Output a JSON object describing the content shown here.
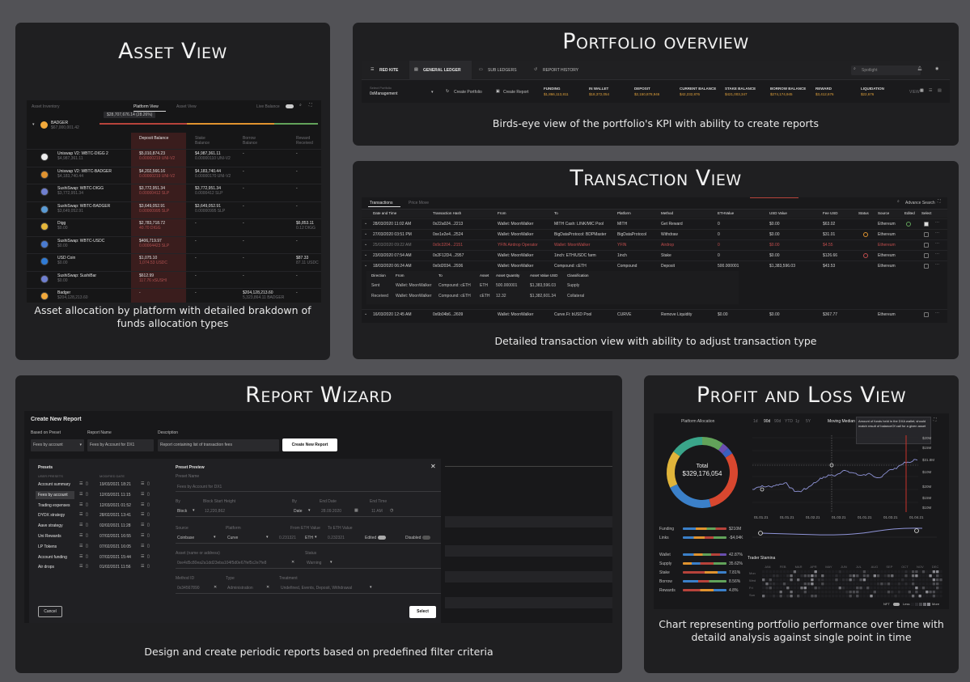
{
  "cards": {
    "asset": {
      "title": "Asset View",
      "caption": "Asset allocation by platform with detailed brakdown of funds allocation types"
    },
    "portfolio": {
      "title": "Portfolio overview",
      "caption": "Birds-eye view of the portfolio's KPI with ability to create reports"
    },
    "transaction": {
      "title": "Transaction View",
      "caption": "Detailed transaction view with ability to adjust transaction type"
    },
    "report": {
      "title": "Report Wizard",
      "caption": "Design and create periodic reports based on predefined filter criteria"
    },
    "pnl": {
      "title": "Profit and Loss View",
      "caption": "Chart representing portfolio performance over time with detaild analysis against single point in time"
    }
  },
  "asset_view": {
    "heading": "Asset Inventory",
    "tab_platform": "Platform View",
    "tab_asset": "Asset View",
    "tooltip": "$28,707,676.14 (28.26%)",
    "toggle_label": "Live Balance",
    "group_name": "BADGER",
    "group_value": "$67,000,001.42",
    "col_deposit": "Deposit Balance",
    "col_stake": "Stake Balance",
    "col_borrow": "Borrow Balance",
    "col_reward": "Reward Received",
    "rows": [
      {
        "name": "Uniswap V2: WBTC-DIGG 2",
        "val": "$4,987,361.11",
        "dep": "$5,010,874.23",
        "dep2": "0.00000219 UNI-V2",
        "stake": "$4,987,361.11",
        "stake2": "0.00000110 UNI-V2",
        "borrow": "-",
        "reward": "-",
        "reward2": ""
      },
      {
        "name": "Uniswap V2: WBTC-BADGER",
        "val": "$4,183,740.44",
        "dep": "$4,202,566.16",
        "dep2": "0.00000219 UNI-V2",
        "stake": "$4,183,740.44",
        "stake2": "0.00000170 UNI-V2",
        "borrow": "-",
        "reward": "-",
        "reward2": ""
      },
      {
        "name": "SushiSwap: WBTC-DIGG",
        "val": "$3,772,951.34",
        "dep": "$3,772,951.34",
        "dep2": "0.00000412 SLP",
        "stake": "$3,772,951.34",
        "stake2": "0.0000412 SLP",
        "borrow": "-",
        "reward": "-",
        "reward2": ""
      },
      {
        "name": "SushiSwap: WBTC-BADGER",
        "val": "$3,649,052.91",
        "dep": "$3,649,052.91",
        "dep2": "0.00000995 SLP",
        "stake": "$3,649,052.91",
        "stake2": "0.00000995 SLP",
        "borrow": "-",
        "reward": "-",
        "reward2": ""
      },
      {
        "name": "Digg",
        "val": "$0.00",
        "dep": "$2,783,718.72",
        "dep2": "40.70 DIGG",
        "stake": "-",
        "stake2": "",
        "borrow": "-",
        "reward": "$6,853.11",
        "reward2": "0.12 DIGG"
      },
      {
        "name": "SushiSwap: WBTC-USDC",
        "val": "$0.00",
        "dep": "$406,719.97",
        "dep2": "0.00004423 SLP",
        "stake": "-",
        "stake2": "",
        "borrow": "-",
        "reward": "-",
        "reward2": ""
      },
      {
        "name": "USD Coin",
        "val": "$0.00",
        "dep": "$1,075.10",
        "dep2": "1,074.53 USDC",
        "stake": "-",
        "stake2": "",
        "borrow": "-",
        "reward": "$87.33",
        "reward2": "87.11 USDC"
      },
      {
        "name": "SushiSwap: SushiBar",
        "val": "$0.00",
        "dep": "$612.99",
        "dep2": "117.76 xSUSHI",
        "stake": "-",
        "stake2": "",
        "borrow": "-",
        "reward": "-",
        "reward2": ""
      },
      {
        "name": "Badger",
        "val": "$204,128,213.60",
        "dep": "-",
        "dep2": "",
        "stake": "-",
        "stake2": "",
        "borrow": "$204,128,213.60",
        "reward": "-",
        "reward2": "",
        "borrow2": "5,323,864.11 BADGER"
      }
    ]
  },
  "portfolio_view": {
    "brand": "RED KITE",
    "tabs": [
      "GENERAL LEDGER",
      "SUB LEDGERS",
      "REPORT HISTORY"
    ],
    "search": "Spotlight",
    "select_label": "Select Portfolio",
    "select_value": "0xManagement",
    "create_portfolio": "Create Portfolio",
    "create_report": "Create Report",
    "kpis": [
      {
        "label": "FUNDING",
        "value": "$1,866,113,811"
      },
      {
        "label": "IN WALLET",
        "value": "$18,372,054"
      },
      {
        "label": "DEPOSIT",
        "value": "$2,150,878,946"
      },
      {
        "label": "CURRENT BALANCE",
        "value": "$42,232,876"
      },
      {
        "label": "STAKE BALANCE",
        "value": "$421,003,347"
      },
      {
        "label": "BORROW BALANCE",
        "value": "$274,174,945"
      },
      {
        "label": "REWARD",
        "value": "$3,412,676"
      },
      {
        "label": "LIQUIDATION",
        "value": "$22,676"
      }
    ],
    "view_label": "VIEW"
  },
  "transaction_view": {
    "tabs": [
      "Transactions",
      "Price Move"
    ],
    "advance": "Advance Search",
    "cols": [
      "Date and Time",
      "Transaction Hash",
      "From",
      "To",
      "Platform",
      "Method",
      "ETHValue",
      "USD Value",
      "Fee USD",
      "Status",
      "Source",
      "Edited",
      "Select"
    ],
    "rows": [
      {
        "date": "28/03/2020 11:02 AM",
        "hash": "0x22a024...2213",
        "from": "Wallet: MoonWalker",
        "to": "MITH Cash: LINK/MIC Pool",
        "platform": "MITH",
        "method": "Get Reward",
        "eth": "0",
        "usd": "$0.00",
        "fee": "$63.02",
        "source": "Ethereum",
        "muted": false
      },
      {
        "date": "27/03/2020 03:51 PM",
        "hash": "0xe1e2e4...2524",
        "from": "Wallet: MoonWalker",
        "to": "BigDataProtocol: BDPMaster",
        "platform": "BigDataProtocol",
        "method": "Withdraw",
        "eth": "0",
        "usd": "$0.00",
        "fee": "$31.01",
        "source": "Ethereum",
        "muted": false
      },
      {
        "date": "25/03/2020 09:22 AM",
        "hash": "0x9c3204...2151",
        "from": "YFIN Airdrop Operator",
        "to": "Wallet: MoonWalker",
        "platform": "YFIN",
        "method": "Airdrop",
        "eth": "0",
        "usd": "$0.00",
        "fee": "$4.55",
        "source": "Ethereum",
        "muted": true
      },
      {
        "date": "23/03/2020 07:54 AM",
        "hash": "0x2F12D4...2957",
        "from": "Wallet: MoonWalker",
        "to": "1inch: ETH/USDC farm",
        "platform": "1inch",
        "method": "Stake",
        "eth": "0",
        "usd": "$0.00",
        "fee": "$126.66",
        "source": "Ethereum",
        "muted": false
      },
      {
        "date": "18/03/2020 06:24 AM",
        "hash": "0x0d2034...2936",
        "from": "Wallet: MoonWalker",
        "to": "Compound: cETH",
        "platform": "Compound",
        "method": "Deposit",
        "eth": "500.000001",
        "usd": "$1,383,596.03",
        "fee": "$43.53",
        "source": "Ethereum",
        "muted": false
      }
    ],
    "sub_cols": [
      "Direction",
      "From",
      "To",
      "Asset",
      "Asset Quantity",
      "Asset Value USD",
      "Classification"
    ],
    "sub_rows": [
      [
        "Sent",
        "Wallet: MoonWalker",
        "Compound: cETH",
        "ETH",
        "500.000001",
        "$1,383,596.03",
        "Supply"
      ],
      [
        "Received",
        "Wallet: MoonWalker",
        "Compound: cETH",
        "cETH",
        "12.32",
        "$1,382,601.34",
        "Collateral"
      ]
    ],
    "last_row": {
      "date": "16/03/2020 12:45 AM",
      "hash": "0x6b04b6...2609",
      "from": "Wallet: MoonWalker",
      "to": "Curve.Fi: bUSD Pool",
      "platform": "CURVE",
      "method": "Remove Liquidity",
      "eth": "$0.00",
      "usd": "$0.00",
      "fee": "$367.77",
      "source": "Ethereum"
    }
  },
  "report_wizard": {
    "header": "Create New Report",
    "lbl_preset": "Based on Preset",
    "lbl_name": "Report Name",
    "lbl_desc": "Description",
    "preset_val": "Fees by account",
    "name_val": "Fees by Account for DX1",
    "desc_val": "Report containing list of transaction fees",
    "create_btn": "Create New Report",
    "presets_title": "Presets",
    "presets_col1": "USER PRESETS",
    "presets_col2": "MODIFIED DATE",
    "presets": [
      {
        "name": "Account summary",
        "date": "19/03/2021 18:21"
      },
      {
        "name": "Fees by account",
        "date": "12/03/2021 11:15"
      },
      {
        "name": "Trading expenses",
        "date": "12/03/2021 01:52"
      },
      {
        "name": "DYDX strategy",
        "date": "28/02/2021 13:41"
      },
      {
        "name": "Aave strategy",
        "date": "02/02/2021 11:28"
      },
      {
        "name": "Uni Rewards",
        "date": "07/02/2021 16:55"
      },
      {
        "name": "LP Tokens",
        "date": "07/02/2021 16:05"
      },
      {
        "name": "Account funding",
        "date": "07/02/2021 15:44"
      },
      {
        "name": "Air drops",
        "date": "01/02/2021 11:56"
      }
    ],
    "preview_title": "Preset Preview",
    "preset_name_lbl": "Preset Name",
    "preset_name_val": "Fees by Account for DX1",
    "by_lbl": "By",
    "by_val": "Block",
    "block_lbl": "Block Start Height",
    "block_val": "12,220,862",
    "by2_lbl": "By",
    "by2_val": "Date",
    "end_lbl": "End Date",
    "end_val": "28.09.2020",
    "endt_lbl": "End Time",
    "endt_val": "11 AM",
    "src_lbl": "Source",
    "src_val": "Coinbase",
    "plat_lbl": "Platform",
    "plat_val": "Curve",
    "from_lbl": "From ETH Value",
    "from_val": "0.231321",
    "from_unit": "ETH",
    "to_lbl": "To ETH Value",
    "to_val": "0.232321",
    "edited": "Edited",
    "disabled": "Disabled",
    "asset_lbl": "Asset (name or address)",
    "asset_val": "0xe4d5c80ea2a1dd23eba104f5d0e67fef5c2e7fe8",
    "status_lbl": "Status",
    "status_val": "Warning",
    "method_lbl": "Method ID",
    "method_val": "0x34567890",
    "type_lbl": "Type",
    "type_val": "Administration",
    "treat_lbl": "Treatment",
    "treat_val": "Undefined, Events, Deposit, Withdrawal",
    "cancel": "Cancel",
    "select": "Select",
    "close": "✕"
  },
  "pnl_view": {
    "alloc_title": "Platform Allocation",
    "total_lbl": "Total",
    "total_val": "$329,176,054",
    "ranges": [
      "1d",
      "90d",
      "90d",
      "YTD",
      "1y",
      "5Y"
    ],
    "moving": "Moving Median",
    "tooltip": "Amount of funds held in the DXA wallet; should match result of balanceOf call for a given asset",
    "y_labels": [
      "$20M",
      "$15M",
      "$31.8M",
      "$10M",
      "$20M",
      "$15M",
      "$10M"
    ],
    "x_labels": [
      "01.01.21",
      "01.01.21",
      "01.02.21",
      "01.03.21",
      "01.01.21",
      "01.03.21",
      "01.04.21"
    ],
    "funding_lbl": "Funding",
    "funding_val": "$210M",
    "links_lbl": "Links",
    "links_val": "-$4,04K",
    "breakdown": [
      {
        "label": "Wallet",
        "pct": "42.87%"
      },
      {
        "label": "Supply",
        "pct": "35.62%"
      },
      {
        "label": "Stake",
        "pct": "7.81%"
      },
      {
        "label": "Borrow",
        "pct": "8.56%"
      },
      {
        "label": "Rewards",
        "pct": "4.8%"
      }
    ],
    "trader_title": "Trader Stamina",
    "months": [
      "JAN",
      "FEB",
      "MAR",
      "APR",
      "MAY",
      "JUN",
      "JUL",
      "AUG",
      "SEP",
      "OCT",
      "NOV",
      "DEC"
    ],
    "days": [
      "Mon",
      "Wed",
      "Fri",
      "Sun"
    ],
    "legend": [
      "NFT",
      "Less",
      "More"
    ]
  }
}
